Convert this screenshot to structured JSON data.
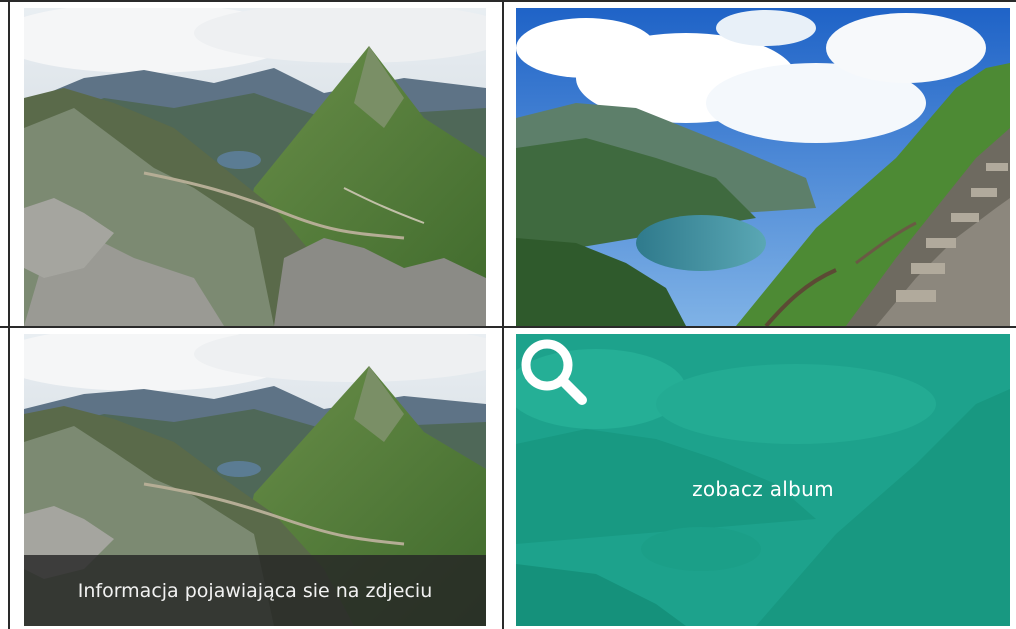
{
  "gallery": {
    "tiles": [
      {
        "name": "tatra-ridge-photo"
      },
      {
        "name": "morskie-oko-lake-photo"
      },
      {
        "name": "tatra-ridge-photo-hover-caption"
      },
      {
        "name": "album-link-tile"
      }
    ],
    "caption": "Informacja pojawiająca sie na zdjeciu",
    "album_link": "zobacz album",
    "overlay_color": "#1aa890",
    "icon": "search-icon"
  }
}
